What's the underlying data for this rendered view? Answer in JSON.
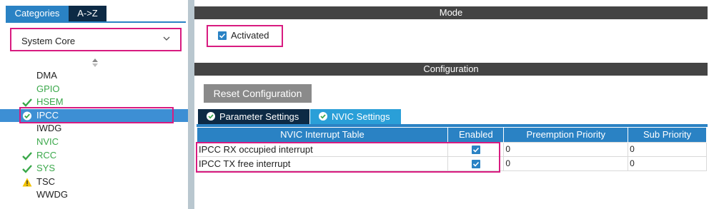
{
  "left_panel": {
    "tabs": {
      "categories": "Categories",
      "a_to_z": "A->Z"
    },
    "category_dropdown": {
      "selected": "System Core"
    },
    "tree_items": [
      {
        "label": "DMA",
        "status": "none"
      },
      {
        "label": "GPIO",
        "status": "none",
        "color": "green"
      },
      {
        "label": "HSEM",
        "status": "check"
      },
      {
        "label": "IPCC",
        "status": "check-circle",
        "selected": true
      },
      {
        "label": "IWDG",
        "status": "none"
      },
      {
        "label": "NVIC",
        "status": "none",
        "color": "green"
      },
      {
        "label": "RCC",
        "status": "check"
      },
      {
        "label": "SYS",
        "status": "check"
      },
      {
        "label": "TSC",
        "status": "warning"
      },
      {
        "label": "WWDG",
        "status": "none"
      }
    ]
  },
  "mode": {
    "title": "Mode",
    "activated_label": "Activated",
    "activated_checked": true
  },
  "configuration": {
    "title": "Configuration",
    "reset_button": "Reset Configuration",
    "tabs": [
      {
        "label": "Parameter Settings",
        "active": false
      },
      {
        "label": "NVIC Settings",
        "active": true
      }
    ],
    "nvic_table": {
      "headers": [
        "NVIC Interrupt Table",
        "Enabled",
        "Preemption Priority",
        "Sub Priority"
      ],
      "rows": [
        {
          "name": "IPCC RX occupied interrupt",
          "enabled": true,
          "preemption": "0",
          "sub": "0"
        },
        {
          "name": "IPCC TX free interrupt",
          "enabled": true,
          "preemption": "0",
          "sub": "0"
        }
      ]
    }
  },
  "colors": {
    "accent_blue": "#2a82c4",
    "dark_navy": "#0d2a45",
    "highlight_pink": "#d81b80",
    "status_green": "#3aa84a",
    "warning_yellow": "#f2c200"
  }
}
